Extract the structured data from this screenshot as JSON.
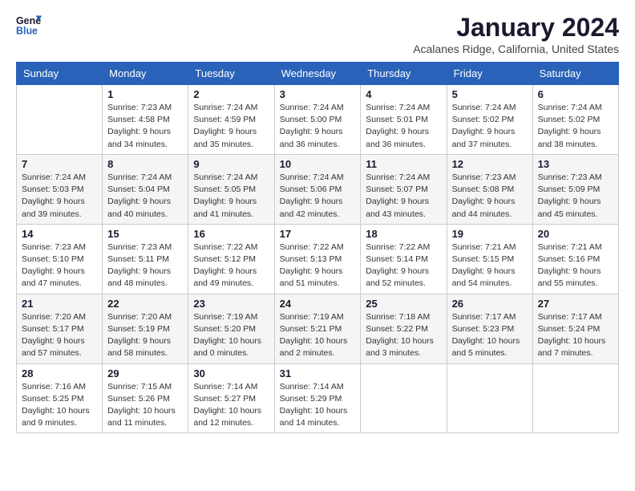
{
  "header": {
    "logo_line1": "General",
    "logo_line2": "Blue",
    "main_title": "January 2024",
    "subtitle": "Acalanes Ridge, California, United States"
  },
  "calendar": {
    "days_of_week": [
      "Sunday",
      "Monday",
      "Tuesday",
      "Wednesday",
      "Thursday",
      "Friday",
      "Saturday"
    ],
    "weeks": [
      [
        {
          "day": "",
          "info": ""
        },
        {
          "day": "1",
          "info": "Sunrise: 7:23 AM\nSunset: 4:58 PM\nDaylight: 9 hours\nand 34 minutes."
        },
        {
          "day": "2",
          "info": "Sunrise: 7:24 AM\nSunset: 4:59 PM\nDaylight: 9 hours\nand 35 minutes."
        },
        {
          "day": "3",
          "info": "Sunrise: 7:24 AM\nSunset: 5:00 PM\nDaylight: 9 hours\nand 36 minutes."
        },
        {
          "day": "4",
          "info": "Sunrise: 7:24 AM\nSunset: 5:01 PM\nDaylight: 9 hours\nand 36 minutes."
        },
        {
          "day": "5",
          "info": "Sunrise: 7:24 AM\nSunset: 5:02 PM\nDaylight: 9 hours\nand 37 minutes."
        },
        {
          "day": "6",
          "info": "Sunrise: 7:24 AM\nSunset: 5:02 PM\nDaylight: 9 hours\nand 38 minutes."
        }
      ],
      [
        {
          "day": "7",
          "info": "Sunrise: 7:24 AM\nSunset: 5:03 PM\nDaylight: 9 hours\nand 39 minutes."
        },
        {
          "day": "8",
          "info": "Sunrise: 7:24 AM\nSunset: 5:04 PM\nDaylight: 9 hours\nand 40 minutes."
        },
        {
          "day": "9",
          "info": "Sunrise: 7:24 AM\nSunset: 5:05 PM\nDaylight: 9 hours\nand 41 minutes."
        },
        {
          "day": "10",
          "info": "Sunrise: 7:24 AM\nSunset: 5:06 PM\nDaylight: 9 hours\nand 42 minutes."
        },
        {
          "day": "11",
          "info": "Sunrise: 7:24 AM\nSunset: 5:07 PM\nDaylight: 9 hours\nand 43 minutes."
        },
        {
          "day": "12",
          "info": "Sunrise: 7:23 AM\nSunset: 5:08 PM\nDaylight: 9 hours\nand 44 minutes."
        },
        {
          "day": "13",
          "info": "Sunrise: 7:23 AM\nSunset: 5:09 PM\nDaylight: 9 hours\nand 45 minutes."
        }
      ],
      [
        {
          "day": "14",
          "info": "Sunrise: 7:23 AM\nSunset: 5:10 PM\nDaylight: 9 hours\nand 47 minutes."
        },
        {
          "day": "15",
          "info": "Sunrise: 7:23 AM\nSunset: 5:11 PM\nDaylight: 9 hours\nand 48 minutes."
        },
        {
          "day": "16",
          "info": "Sunrise: 7:22 AM\nSunset: 5:12 PM\nDaylight: 9 hours\nand 49 minutes."
        },
        {
          "day": "17",
          "info": "Sunrise: 7:22 AM\nSunset: 5:13 PM\nDaylight: 9 hours\nand 51 minutes."
        },
        {
          "day": "18",
          "info": "Sunrise: 7:22 AM\nSunset: 5:14 PM\nDaylight: 9 hours\nand 52 minutes."
        },
        {
          "day": "19",
          "info": "Sunrise: 7:21 AM\nSunset: 5:15 PM\nDaylight: 9 hours\nand 54 minutes."
        },
        {
          "day": "20",
          "info": "Sunrise: 7:21 AM\nSunset: 5:16 PM\nDaylight: 9 hours\nand 55 minutes."
        }
      ],
      [
        {
          "day": "21",
          "info": "Sunrise: 7:20 AM\nSunset: 5:17 PM\nDaylight: 9 hours\nand 57 minutes."
        },
        {
          "day": "22",
          "info": "Sunrise: 7:20 AM\nSunset: 5:19 PM\nDaylight: 9 hours\nand 58 minutes."
        },
        {
          "day": "23",
          "info": "Sunrise: 7:19 AM\nSunset: 5:20 PM\nDaylight: 10 hours\nand 0 minutes."
        },
        {
          "day": "24",
          "info": "Sunrise: 7:19 AM\nSunset: 5:21 PM\nDaylight: 10 hours\nand 2 minutes."
        },
        {
          "day": "25",
          "info": "Sunrise: 7:18 AM\nSunset: 5:22 PM\nDaylight: 10 hours\nand 3 minutes."
        },
        {
          "day": "26",
          "info": "Sunrise: 7:17 AM\nSunset: 5:23 PM\nDaylight: 10 hours\nand 5 minutes."
        },
        {
          "day": "27",
          "info": "Sunrise: 7:17 AM\nSunset: 5:24 PM\nDaylight: 10 hours\nand 7 minutes."
        }
      ],
      [
        {
          "day": "28",
          "info": "Sunrise: 7:16 AM\nSunset: 5:25 PM\nDaylight: 10 hours\nand 9 minutes."
        },
        {
          "day": "29",
          "info": "Sunrise: 7:15 AM\nSunset: 5:26 PM\nDaylight: 10 hours\nand 11 minutes."
        },
        {
          "day": "30",
          "info": "Sunrise: 7:14 AM\nSunset: 5:27 PM\nDaylight: 10 hours\nand 12 minutes."
        },
        {
          "day": "31",
          "info": "Sunrise: 7:14 AM\nSunset: 5:29 PM\nDaylight: 10 hours\nand 14 minutes."
        },
        {
          "day": "",
          "info": ""
        },
        {
          "day": "",
          "info": ""
        },
        {
          "day": "",
          "info": ""
        }
      ]
    ]
  }
}
